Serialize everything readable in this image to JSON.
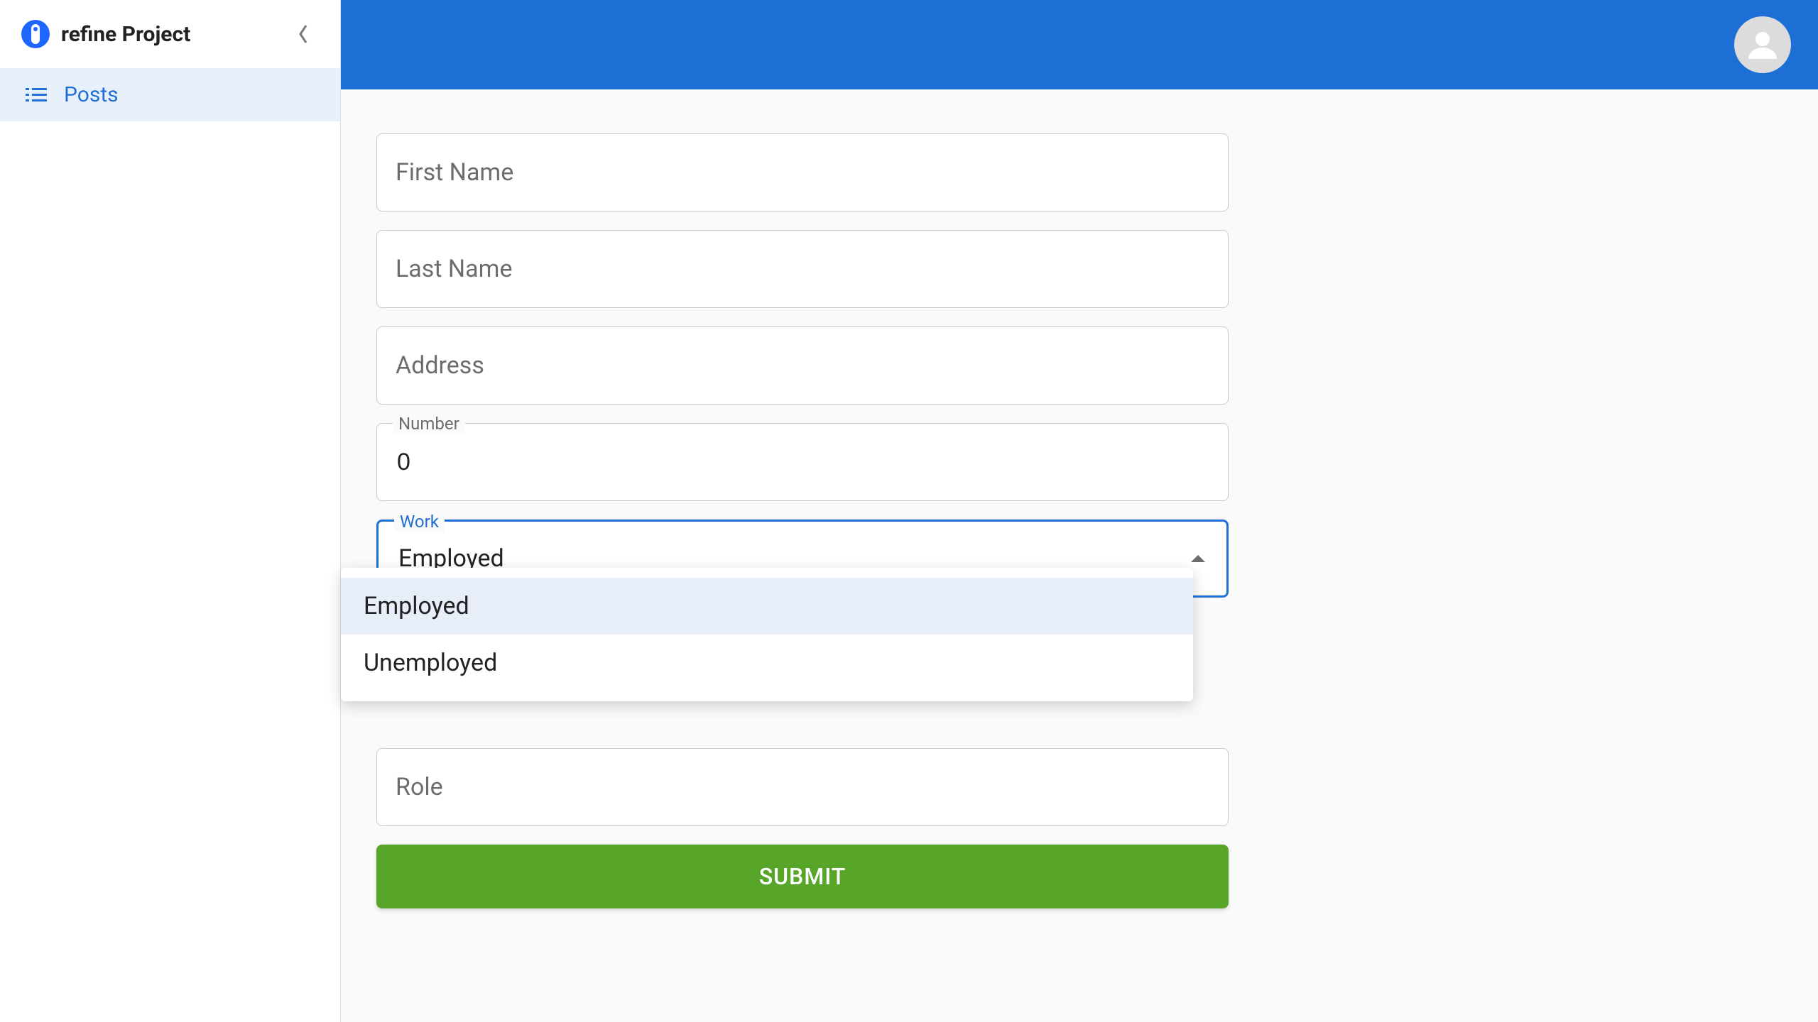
{
  "sidebar": {
    "title": "refine Project",
    "items": [
      {
        "label": "Posts"
      }
    ]
  },
  "form": {
    "first_name": {
      "label": "First Name",
      "value": ""
    },
    "last_name": {
      "label": "Last Name",
      "value": ""
    },
    "address": {
      "label": "Address",
      "value": ""
    },
    "number": {
      "label": "Number",
      "value": "0"
    },
    "work": {
      "label": "Work",
      "value": "Employed",
      "options": [
        "Employed",
        "Unemployed"
      ]
    },
    "role": {
      "label": "Role",
      "value": ""
    },
    "submit": "SUBMIT"
  },
  "colors": {
    "primary": "#1d6fd5",
    "accent": "#57a62a"
  }
}
